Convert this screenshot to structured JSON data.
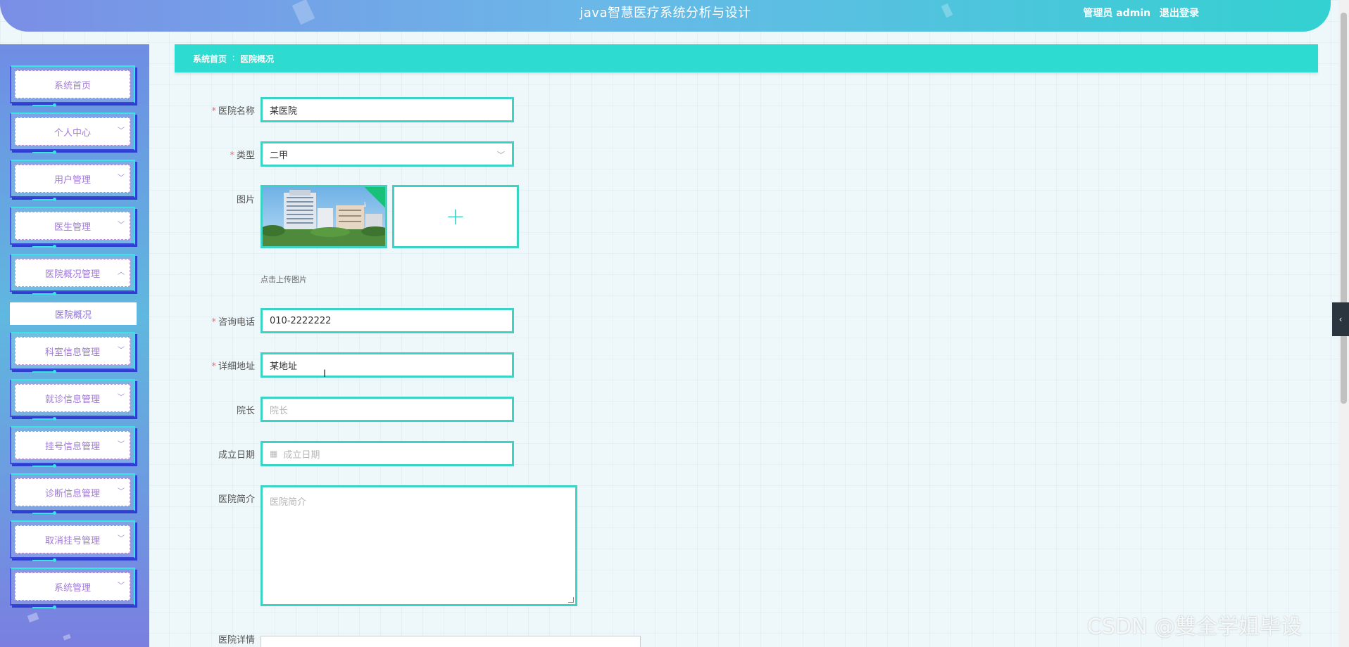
{
  "header": {
    "title": "java智慧医疗系统分析与设计",
    "user": "管理员 admin",
    "logout": "退出登录"
  },
  "sidebar": {
    "items": [
      {
        "label": "系统首页",
        "has_chevron": false
      },
      {
        "label": "个人中心",
        "has_chevron": true
      },
      {
        "label": "用户管理",
        "has_chevron": true
      },
      {
        "label": "医生管理",
        "has_chevron": true
      },
      {
        "label": "医院概况管理",
        "has_chevron": true,
        "expanded": true
      },
      {
        "label": "科室信息管理",
        "has_chevron": true
      },
      {
        "label": "就诊信息管理",
        "has_chevron": true
      },
      {
        "label": "挂号信息管理",
        "has_chevron": true
      },
      {
        "label": "诊断信息管理",
        "has_chevron": true
      },
      {
        "label": "取消挂号管理",
        "has_chevron": true
      },
      {
        "label": "系统管理",
        "has_chevron": true
      }
    ],
    "submenu_active": "医院概况"
  },
  "breadcrumb": {
    "home": "系统首页",
    "separator": "∶",
    "current": "医院概况"
  },
  "form": {
    "name": {
      "label": "医院名称",
      "required": true,
      "value": "某医院"
    },
    "type": {
      "label": "类型",
      "required": true,
      "value": "二甲"
    },
    "image": {
      "label": "图片",
      "hint": "点击上传图片"
    },
    "phone": {
      "label": "咨询电话",
      "required": true,
      "value": "010-2222222"
    },
    "address": {
      "label": "详细地址",
      "required": true,
      "value": "某地址"
    },
    "president": {
      "label": "院长",
      "required": false,
      "placeholder": "院长"
    },
    "founded": {
      "label": "成立日期",
      "required": false,
      "placeholder": "成立日期"
    },
    "intro": {
      "label": "医院简介",
      "required": false,
      "placeholder": "医院简介"
    },
    "details": {
      "label": "医院详情",
      "required": false
    }
  },
  "watermark": "CSDN @雙全学姐毕设",
  "colors": {
    "accent": "#3cd3c7",
    "breadcrumb_bg": "#2ddbd0",
    "required": "#f56c6c",
    "menu_text": "#a07ad6"
  }
}
